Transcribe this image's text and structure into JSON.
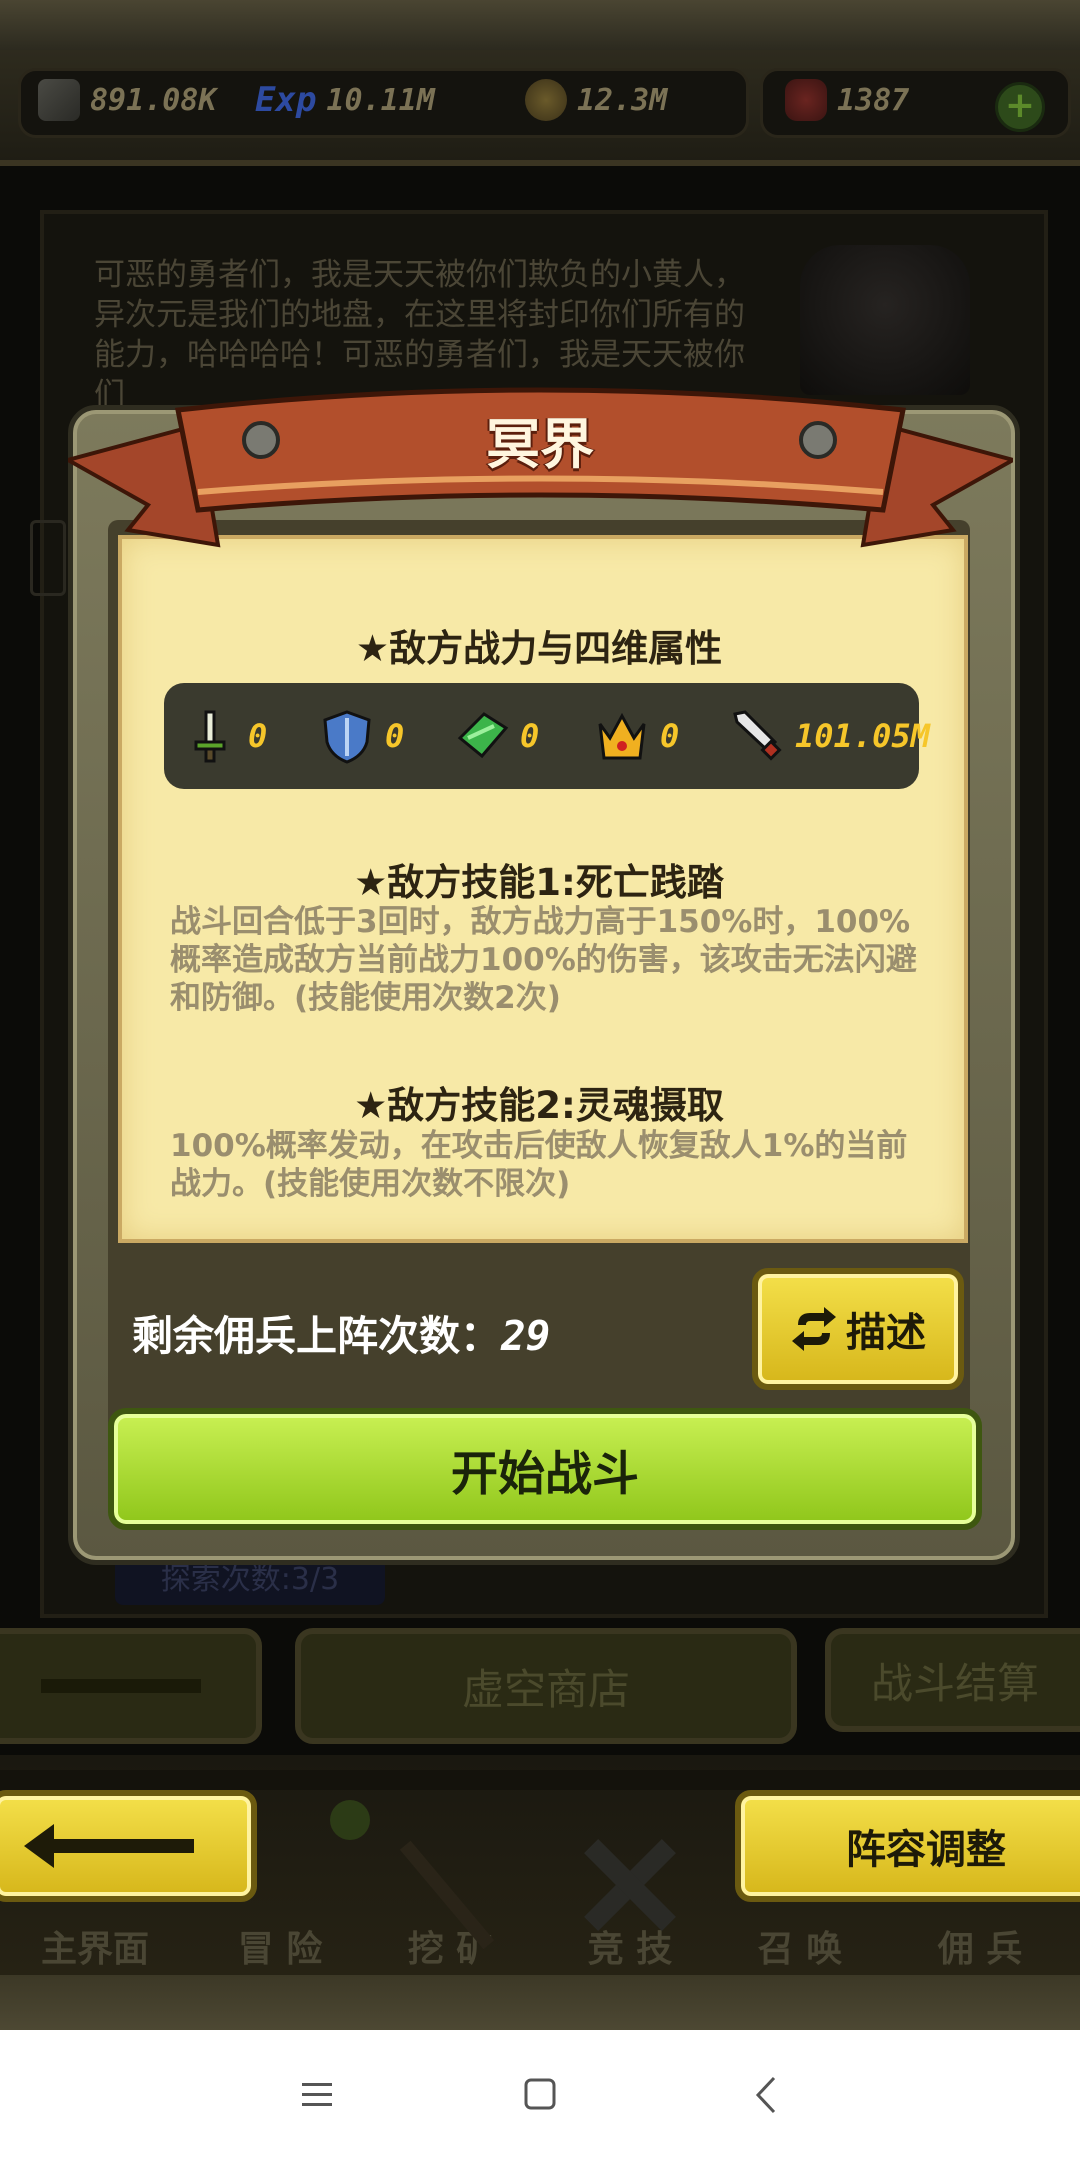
{
  "resources": {
    "power": "891.08K",
    "exp_label": "Exp",
    "exp": "10.11M",
    "coins": "12.3M",
    "gems": "1387",
    "add_icon": "plus-icon"
  },
  "background": {
    "story_text": "可恶的勇者们，我是天天被你们欺负的小黄人，异次元是我们的地盘，在这里将封印你们所有的能力，哈哈哈哈！可恶的勇者们，我是天天被你们",
    "explore_text": "探索次数:3/3",
    "void_shop": "虚空商店",
    "battle_settle": "战斗结算",
    "nav": [
      "主界面",
      "冒 险",
      "挖 矿",
      "竞 技",
      "召 唤",
      "佣 兵"
    ]
  },
  "modal": {
    "title": "冥界",
    "attr_heading": "★敌方战力与四维属性",
    "stats": [
      {
        "icon": "sword-green-icon",
        "value": "0"
      },
      {
        "icon": "shield-icon",
        "value": "0"
      },
      {
        "icon": "leaf-icon",
        "value": "0"
      },
      {
        "icon": "crown-icon",
        "value": "0"
      },
      {
        "icon": "sword-icon",
        "value": "101.05M"
      }
    ],
    "skill1_heading": "★敌方技能1:死亡践踏",
    "skill1_desc": "战斗回合低于3回时，敌方战力高于150%时，100%概率造成敌方当前战力100%的伤害，该攻击无法闪避和防御。(技能使用次数2次)",
    "skill2_heading": "★敌方技能2:灵魂摄取",
    "skill2_desc": "100%概率发动，在攻击后使敌人恢复敌人1%的当前战力。(技能使用次数不限次)",
    "remaining_label": "剩余佣兵上阵次数：",
    "remaining_value": "29",
    "describe_label": "描述",
    "start_label": "开始战斗"
  },
  "formation_label": "阵容调整"
}
